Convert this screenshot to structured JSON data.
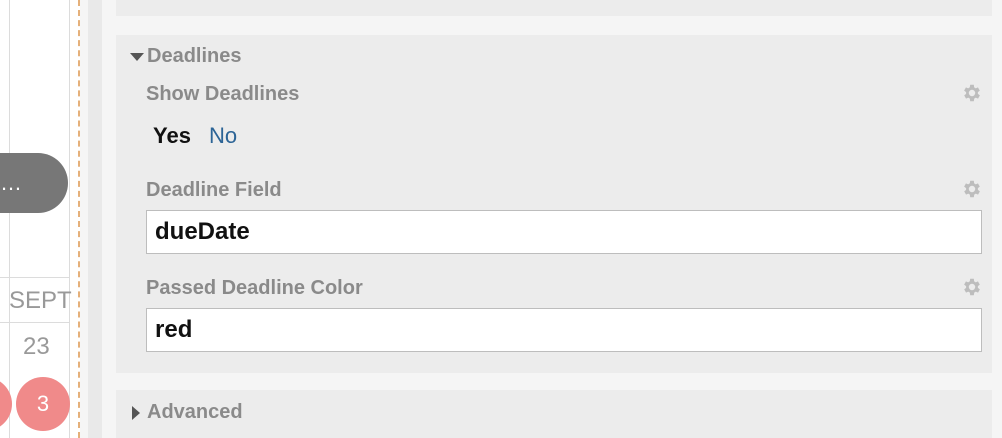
{
  "calendar": {
    "event_pill_label": "…",
    "month_label": "SEPT",
    "day_number": "23",
    "event_count": "3"
  },
  "deadlines": {
    "section_title": "Deadlines",
    "show_deadlines": {
      "label": "Show Deadlines",
      "options": [
        "Yes",
        "No"
      ],
      "selected": "Yes"
    },
    "deadline_field": {
      "label": "Deadline Field",
      "value": "dueDate"
    },
    "passed_deadline_color": {
      "label": "Passed Deadline Color",
      "value": "red"
    }
  },
  "advanced": {
    "section_title": "Advanced"
  },
  "icons": {
    "settings": "gear-icon",
    "expanded": "caret-down-icon",
    "collapsed": "caret-right-icon"
  },
  "colors": {
    "accent_link": "#2c6496",
    "event_badge": "#f08a8a",
    "event_pill": "#777777"
  }
}
